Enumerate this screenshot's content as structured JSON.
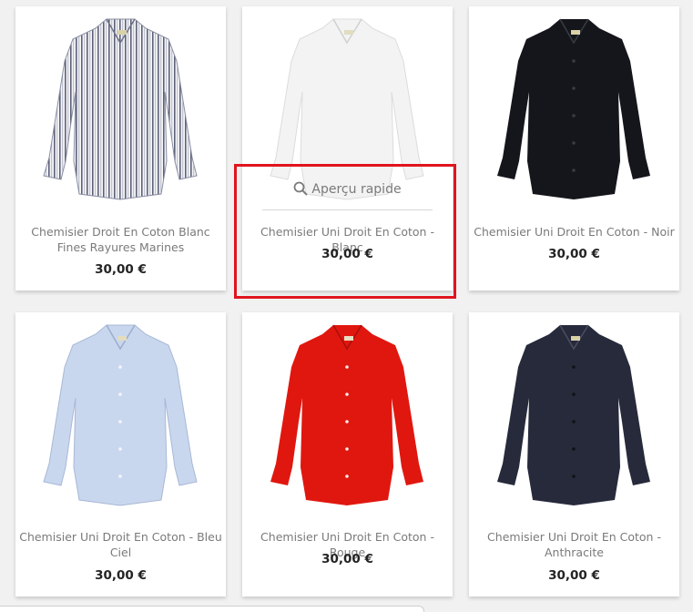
{
  "products": [
    {
      "title": "Chemisier Droit En Coton Blanc Fines Rayures Marines",
      "price": "30,00 €",
      "image": "striped-shirt-image"
    },
    {
      "title": "Chemisier Uni Droit En Coton - Blanc",
      "price": "30,00 €",
      "image": "white-shirt-image"
    },
    {
      "title": "Chemisier Uni Droit En Coton - Noir",
      "price": "30,00 €",
      "image": "black-shirt-image"
    },
    {
      "title": "Chemisier Uni Droit En Coton - Bleu Ciel",
      "price": "30,00 €",
      "image": "light-blue-shirt-image"
    },
    {
      "title": "Chemisier Uni Droit En Coton - Rouge",
      "price": "30,00 €",
      "image": "red-shirt-image"
    },
    {
      "title": "Chemisier Uni Droit En Coton - Anthracite",
      "price": "30,00 €",
      "image": "anthracite-shirt-image"
    }
  ],
  "quick_view": {
    "label": "Aperçu rapide",
    "icon": "search-icon"
  },
  "colors": {
    "highlight": "#e0141e",
    "shirt_white": "#f3f3f3",
    "shirt_black": "#15161c",
    "shirt_light_blue": "#c9d7ee",
    "shirt_red": "#e0170f",
    "shirt_anthracite": "#262a3b"
  }
}
